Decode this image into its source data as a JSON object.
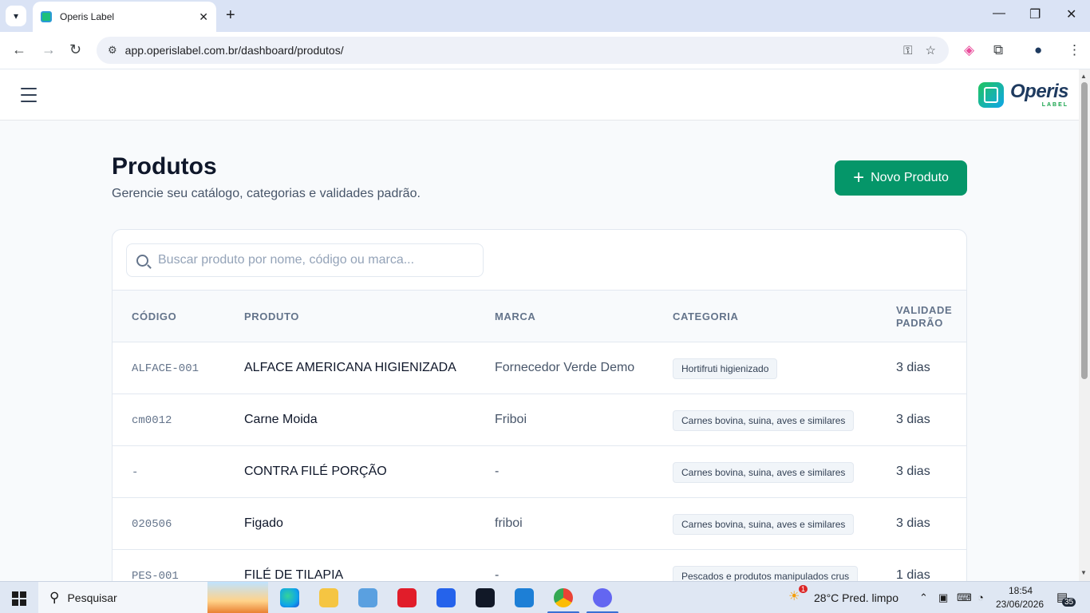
{
  "browser": {
    "tab_title": "Operis Label",
    "url": "app.operislabel.com.br/dashboard/produtos/"
  },
  "brand": {
    "name": "Operis",
    "sub": "LABEL",
    "accent": "#059669"
  },
  "page": {
    "title": "Produtos",
    "subtitle": "Gerencie seu catálogo, categorias e validades padrão.",
    "new_button": "Novo Produto"
  },
  "search": {
    "placeholder": "Buscar produto por nome, código ou marca...",
    "value": ""
  },
  "table": {
    "headers": {
      "code": "CÓDIGO",
      "product": "PRODUTO",
      "brand": "MARCA",
      "category": "CATEGORIA",
      "validity_1": "VALIDADE",
      "validity_2": "PADRÃO"
    },
    "rows": [
      {
        "code": "ALFACE-001",
        "product": "ALFACE AMERICANA HIGIENIZADA",
        "brand": "Fornecedor Verde Demo",
        "category": "Hortifruti higienizado",
        "validity": "3 dias"
      },
      {
        "code": "cm0012",
        "product": "Carne Moida",
        "brand": "Friboi",
        "category": "Carnes bovina, suina, aves e similares",
        "validity": "3 dias"
      },
      {
        "code": "-",
        "product": "CONTRA FILÉ PORÇÃO",
        "brand": "-",
        "category": "Carnes bovina, suina, aves e similares",
        "validity": "3 dias"
      },
      {
        "code": "020506",
        "product": "Figado",
        "brand": "friboi",
        "category": "Carnes bovina, suina, aves e similares",
        "validity": "3 dias"
      },
      {
        "code": "PES-001",
        "product": "FILÉ DE TILAPIA",
        "brand": "-",
        "category": "Pescados e produtos manipulados crus",
        "validity": "1 dias"
      }
    ]
  },
  "taskbar": {
    "search_label": "Pesquisar",
    "weather_badge": "1",
    "weather": "28°C  Pred. limpo",
    "time": "18:54",
    "date": "23/06/2026",
    "notifications": "35"
  }
}
